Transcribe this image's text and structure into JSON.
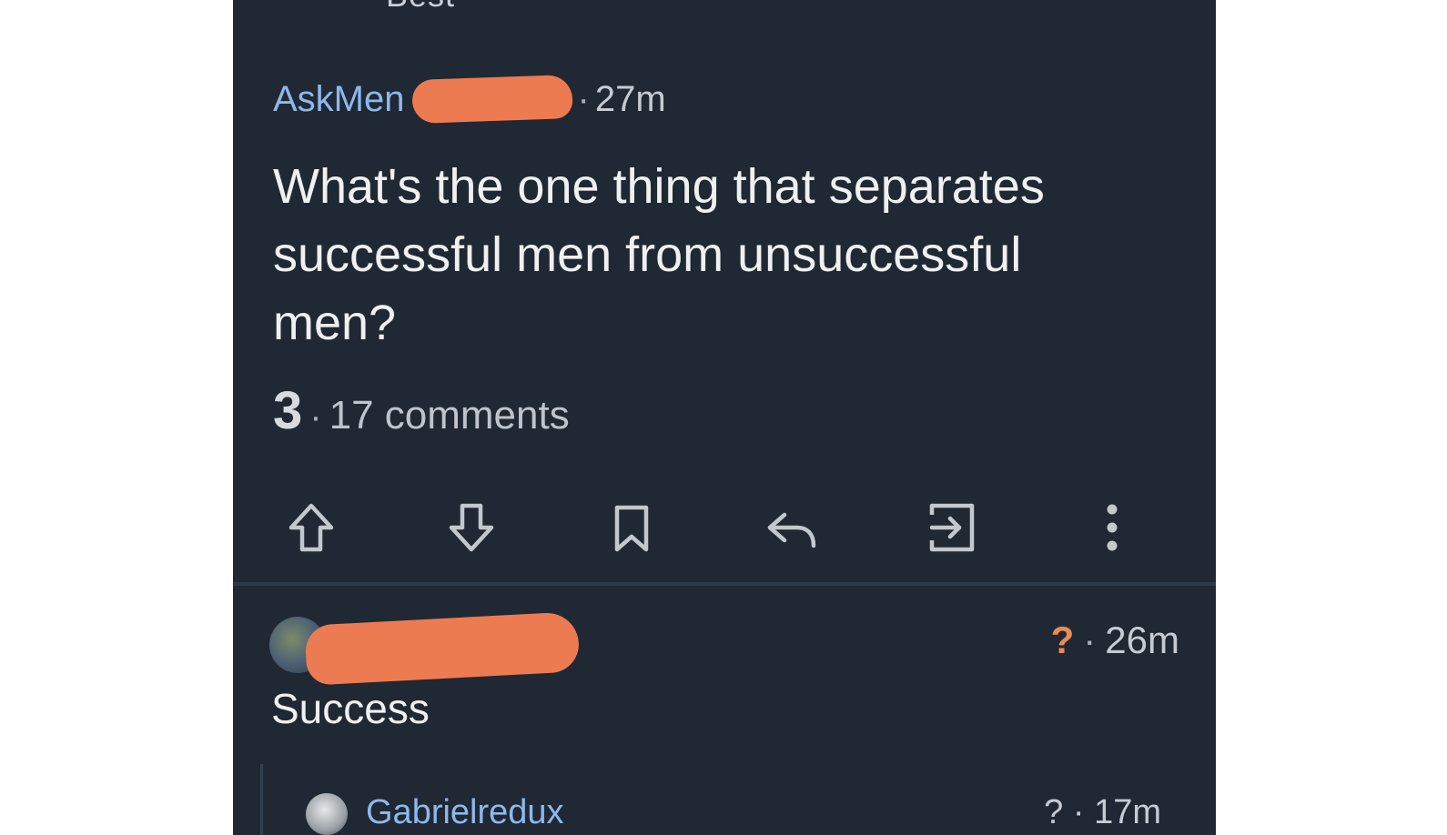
{
  "header": {
    "sort_label": "Best"
  },
  "post": {
    "subreddit": "AskMen",
    "meta_separator": "·",
    "time": "27m",
    "title": "What's the one thing that separates successful men from unsuccessful men?",
    "score": "3",
    "stats_separator": "·",
    "comments": "17 comments"
  },
  "toolbar": {
    "icons": [
      "upvote-icon",
      "downvote-icon",
      "bookmark-icon",
      "reply-icon",
      "share-icon",
      "more-icon"
    ],
    "icon_color": "#c3c8cf"
  },
  "comment": {
    "flag": "?",
    "separator": "·",
    "time": "26m",
    "body": "Success"
  },
  "reply": {
    "username": "Gabrielredux",
    "meta": "? · 17m"
  },
  "colors": {
    "background": "#202833",
    "subreddit_link": "#8db8ec",
    "redaction": "#ec7b52",
    "flag": "#ea8a55"
  }
}
